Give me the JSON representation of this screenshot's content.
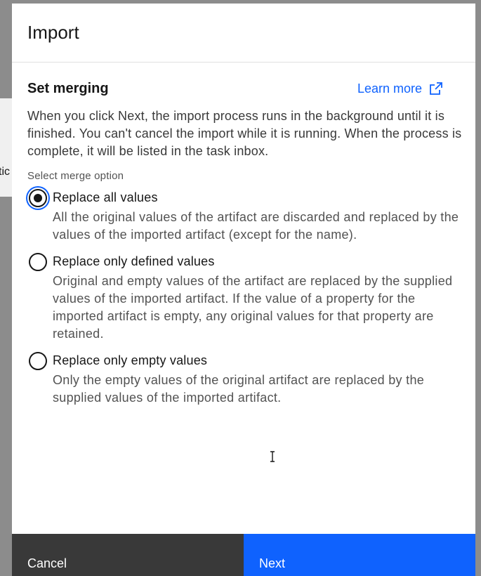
{
  "background": {
    "partial_text": "tic"
  },
  "modal": {
    "title": "Import",
    "section_title": "Set merging",
    "learn_more": "Learn more",
    "description": "When you click Next, the import process runs in the background until it is finished. You can't cancel the import while it is running. When the process is complete, it will be listed in the task inbox.",
    "field_label": "Select merge option",
    "options": [
      {
        "label": "Replace all values",
        "description": "All the original values of the artifact are discarded and replaced by the values of the imported artifact (except for the name).",
        "selected": true
      },
      {
        "label": "Replace only defined values",
        "description": "Original and empty values of the artifact are replaced by the supplied values of the imported artifact. If the value of a property for the imported artifact is empty, any original values for that property are retained.",
        "selected": false
      },
      {
        "label": "Replace only empty values",
        "description": "Only the empty values of the original artifact are replaced by the supplied values of the imported artifact.",
        "selected": false
      }
    ],
    "footer": {
      "cancel_label": "Cancel",
      "next_label": "Next"
    }
  },
  "colors": {
    "primary": "#0f62fe",
    "secondary_button": "#393939",
    "text": "#161616"
  }
}
